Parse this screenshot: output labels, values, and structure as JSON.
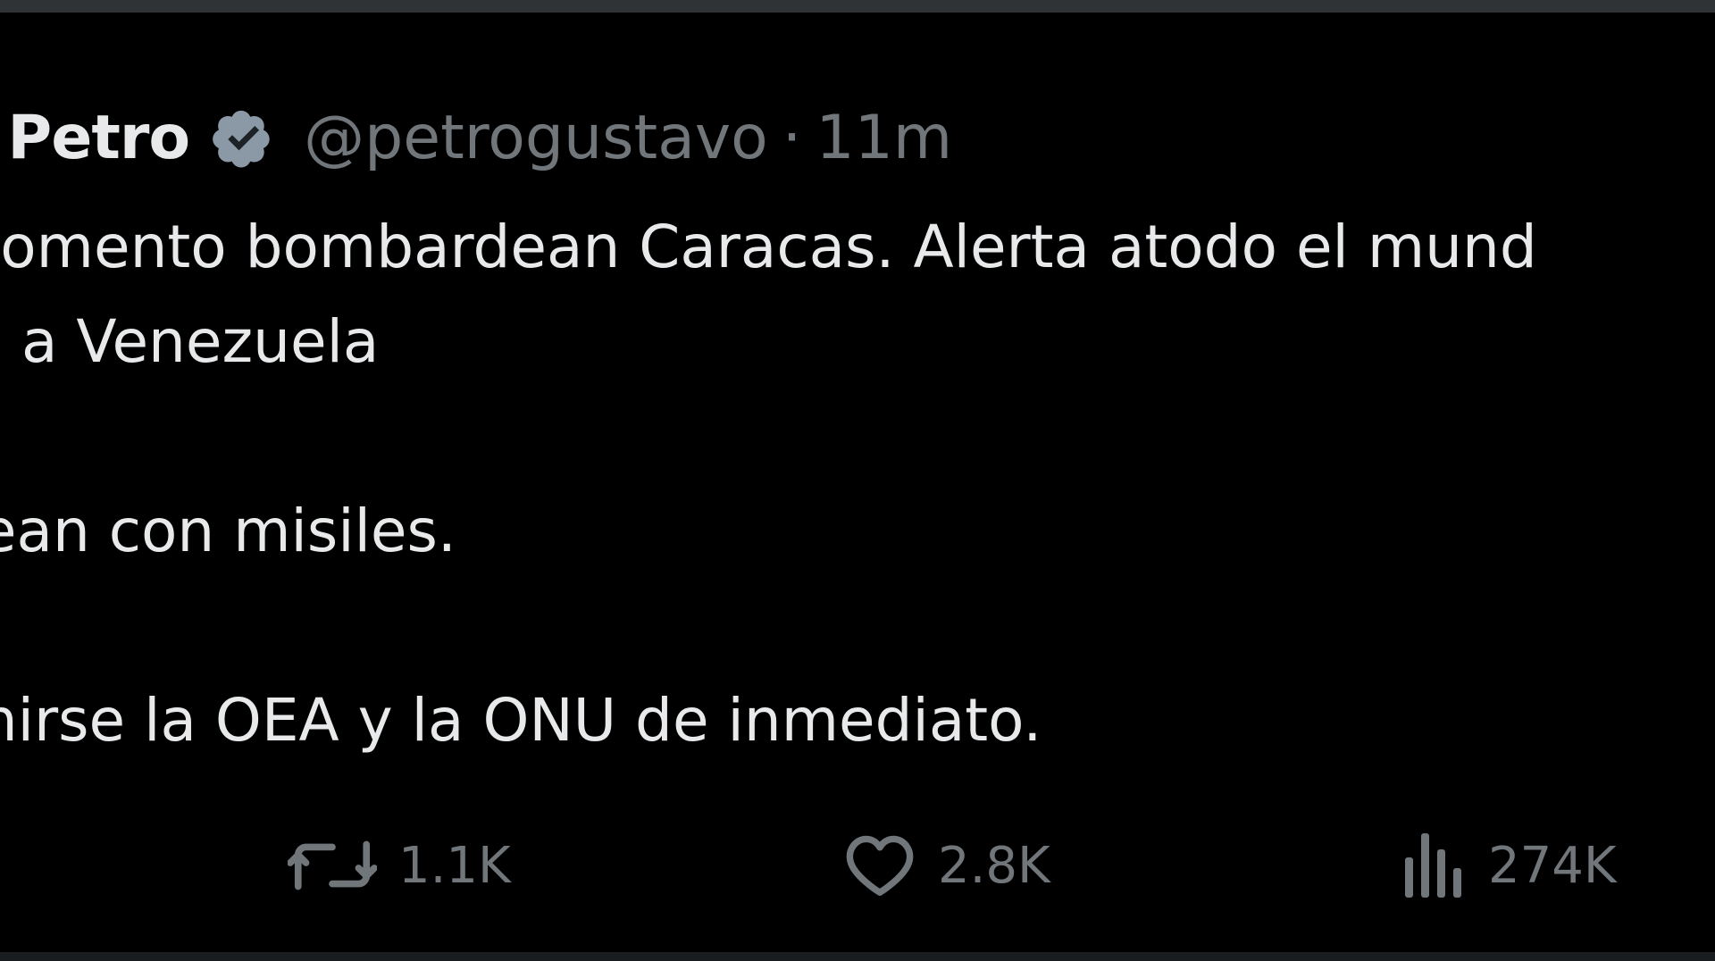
{
  "tweet": {
    "display_name": "o Petro",
    "verified_icon": "verified-badge-icon",
    "handle": "@petrogustavo",
    "separator": "·",
    "time": "11m",
    "lines": [
      "momento bombardean Caracas. Alerta atodo el mund",
      "a Venezuela",
      "",
      "dean con misiles.",
      "",
      "unirse la OEA y la ONU de inmediato."
    ]
  },
  "actions": {
    "retweet": {
      "icon": "retweet-icon",
      "count": "1.1K"
    },
    "like": {
      "icon": "heart-icon",
      "count": "2.8K"
    },
    "views": {
      "icon": "views-chart-icon",
      "count": "274K"
    }
  },
  "colors": {
    "background": "#000000",
    "text": "#e7e9ea",
    "muted": "#71767b",
    "verified": "#8b98a5"
  }
}
